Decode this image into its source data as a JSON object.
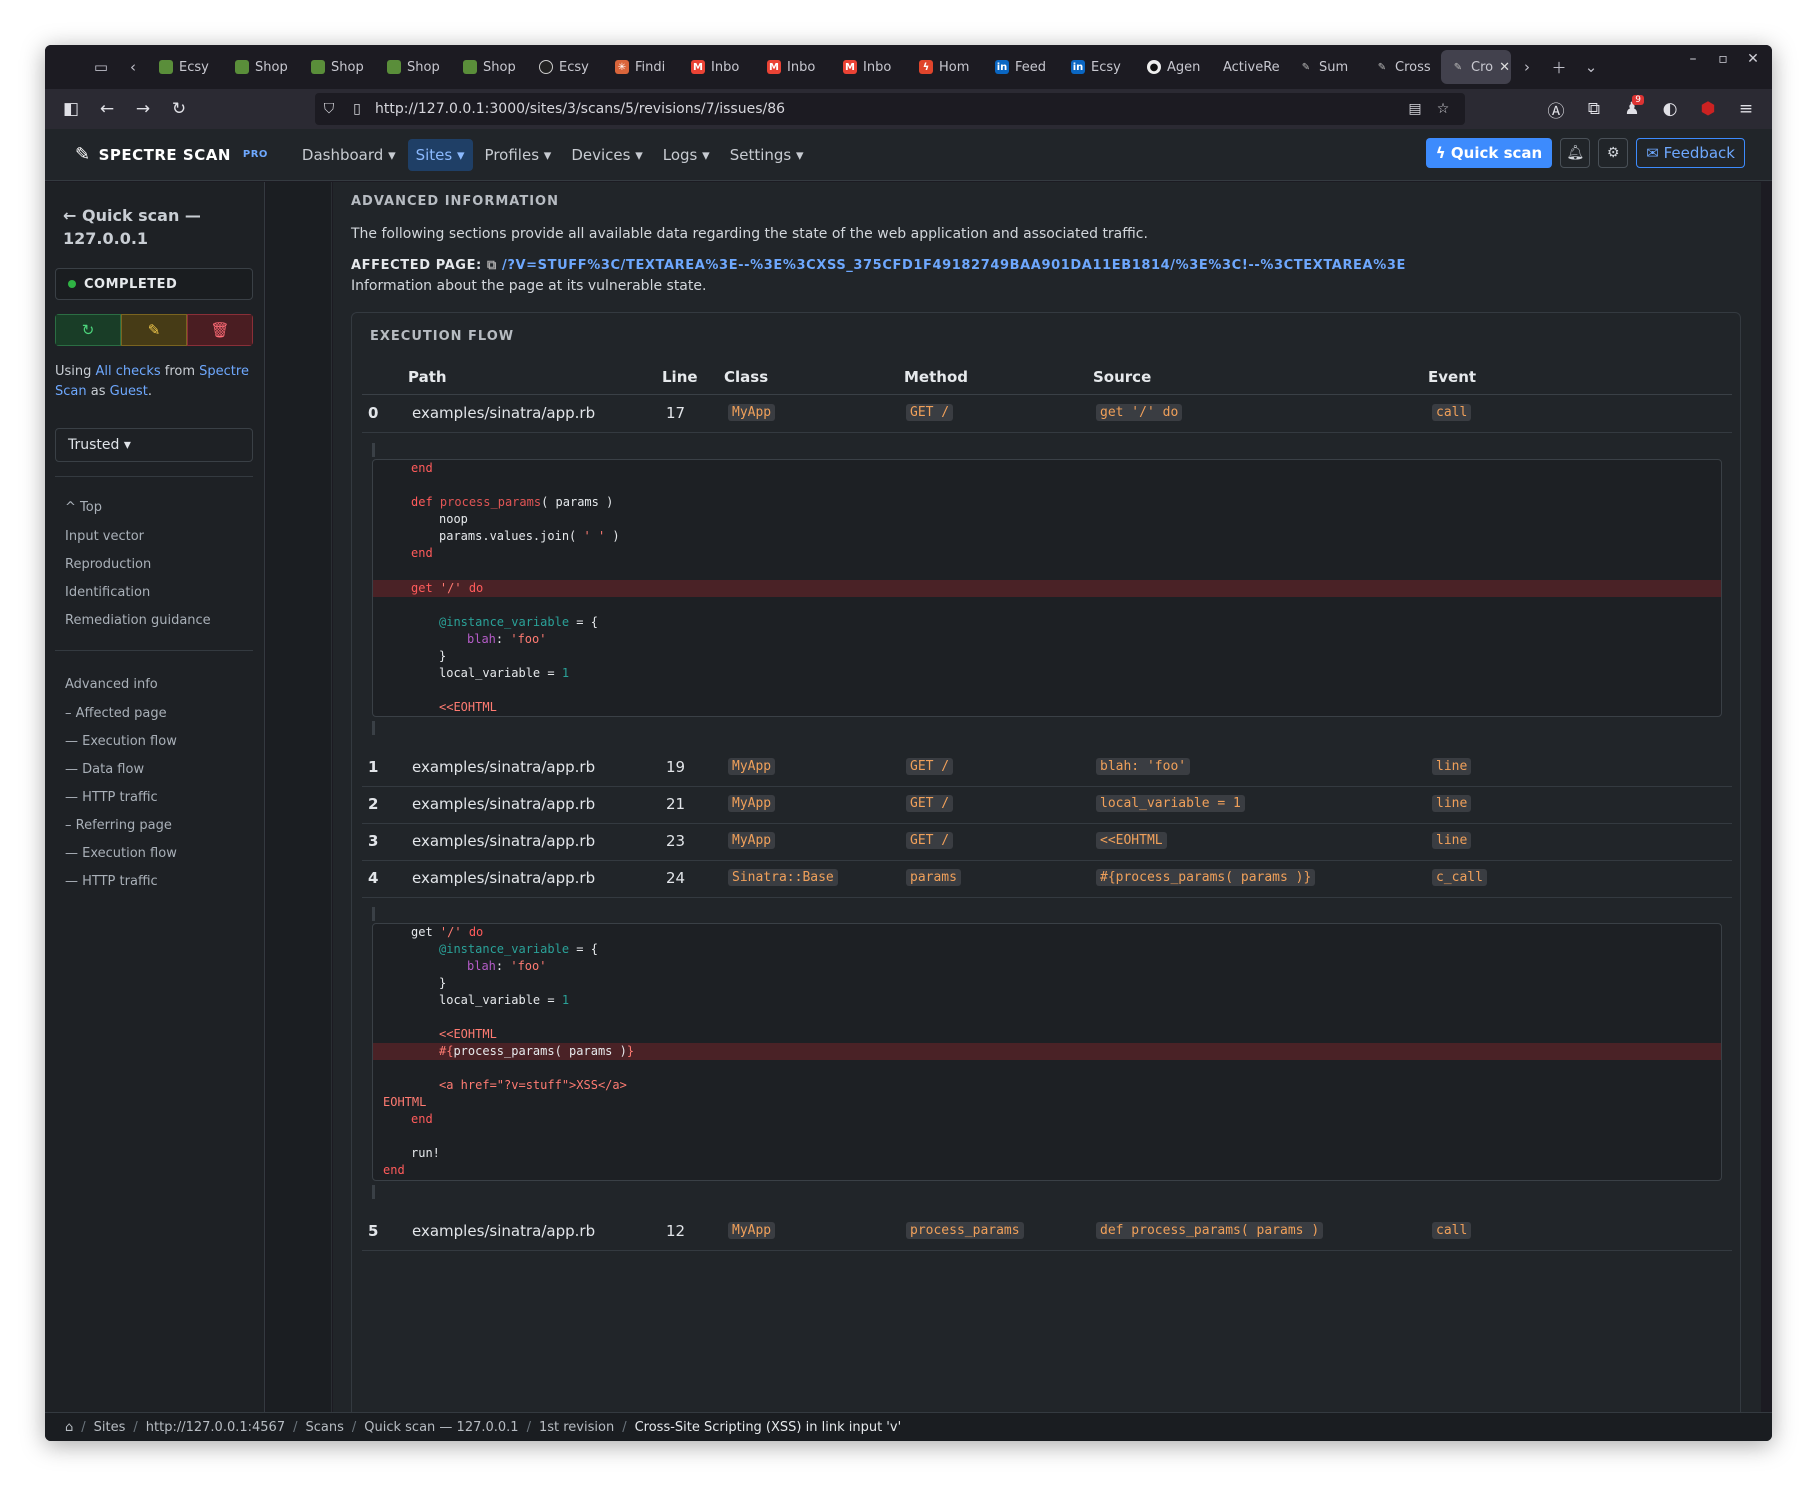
{
  "browser": {
    "tabs": [
      "Ecsy",
      "Shop",
      "Shop",
      "Shop",
      "Shop",
      "Ecsy",
      "Findi",
      "Inbo",
      "Inbo",
      "Inbo",
      "Hom",
      "Feed",
      "Ecsy",
      "Agen",
      "ActiveRe",
      "Sum",
      "Cross",
      "Cro"
    ],
    "url": "http://127.0.0.1:3000/sites/3/scans/5/revisions/7/issues/86",
    "badge_count": "9"
  },
  "header": {
    "brand": "SPECTRE SCAN",
    "brand_sup": "PRO",
    "menu": [
      "Dashboard",
      "Sites",
      "Profiles",
      "Devices",
      "Logs",
      "Settings"
    ],
    "quick_scan": "Quick scan",
    "feedback": "Feedback"
  },
  "sidebar": {
    "title": "Quick scan — 127.0.0.1",
    "status": "COMPLETED",
    "using_prefix": "Using ",
    "checks_link": "All checks",
    "from": " from ",
    "spectre_link": "Spectre Scan",
    "as": " as ",
    "guest_link": "Guest",
    "period": ".",
    "trusted": "Trusted",
    "toc": [
      "Top",
      "Input vector",
      "Reproduction",
      "Identification",
      "Remediation guidance"
    ],
    "toc2": [
      "Advanced info",
      "– Affected page",
      "— Execution flow",
      "— Data flow",
      "— HTTP traffic",
      "– Referring page",
      "— Execution flow",
      "— HTTP traffic"
    ]
  },
  "main": {
    "section_title": "ADVANCED INFORMATION",
    "section_desc": "The following sections provide all available data regarding the state of the web application and associated traffic.",
    "affected_label": "AFFECTED PAGE:",
    "affected_link": "/?V=STUFF%3C/TEXTAREA%3E--%3E%3CXSS_375CFD1F49182749BAA901DA11EB1814/%3E%3C!--%3CTEXTAREA%3E",
    "affected_desc": "Information about the page at its vulnerable state.",
    "card_title": "EXECUTION FLOW",
    "columns": [
      "Path",
      "Line",
      "Class",
      "Method",
      "Source",
      "Event"
    ],
    "rows": [
      {
        "idx": "0",
        "path": "examples/sinatra/app.rb",
        "line": "17",
        "class": "MyApp",
        "method": "GET /",
        "source": "get '/' do",
        "event": "call"
      },
      {
        "idx": "1",
        "path": "examples/sinatra/app.rb",
        "line": "19",
        "class": "MyApp",
        "method": "GET /",
        "source": "blah: 'foo'",
        "event": "line"
      },
      {
        "idx": "2",
        "path": "examples/sinatra/app.rb",
        "line": "21",
        "class": "MyApp",
        "method": "GET /",
        "source": "local_variable = 1",
        "event": "line"
      },
      {
        "idx": "3",
        "path": "examples/sinatra/app.rb",
        "line": "23",
        "class": "MyApp",
        "method": "GET /",
        "source": "<<EOHTML",
        "event": "line"
      },
      {
        "idx": "4",
        "path": "examples/sinatra/app.rb",
        "line": "24",
        "class": "Sinatra::Base",
        "method": "params",
        "source": "#{process_params( params )}",
        "event": "c_call"
      },
      {
        "idx": "5",
        "path": "examples/sinatra/app.rb",
        "line": "12",
        "class": "MyApp",
        "method": "process_params",
        "source": "def process_params( params )",
        "event": "call"
      }
    ],
    "code1": {
      "end1": "end",
      "def_kw": "def",
      "def_name": "process_params",
      "def_args": "( params )",
      "noop": "noop",
      "join": "params.values.join(",
      "join_str": " ' ' ",
      "join_close": ")",
      "end2": "end",
      "get": "get",
      "get_path": " '/' ",
      "do": "do",
      "ivar": "@instance_variable",
      "assign": " = {",
      "blah": "blah",
      "colon": ": ",
      "foo": "'foo'",
      "close": "}",
      "local": "local_variable = ",
      "one": "1",
      "heredoc": "<<EOHTML"
    },
    "code2": {
      "get": "get",
      "get_path": " '/' ",
      "do": "do",
      "ivar": "@instance_variable",
      "assign": " = {",
      "blah": "blah",
      "colon": ": ",
      "foo": "'foo'",
      "close": "}",
      "local": "local_variable = ",
      "one": "1",
      "heredoc": "<<EOHTML",
      "interp_open": "#{",
      "interp_body": "process_params( params )",
      "interp_close": "}",
      "anchor": "<a href=\"?v=stuff\">XSS</a>",
      "eohtml": "EOHTML",
      "end1": "end",
      "run": "run!",
      "end2": "end"
    }
  },
  "breadcrumb": [
    "Sites",
    "http://127.0.0.1:4567",
    "Scans",
    "Quick scan — 127.0.0.1",
    "1st revision",
    "Cross-Site Scripting (XSS) in link input 'v'"
  ]
}
